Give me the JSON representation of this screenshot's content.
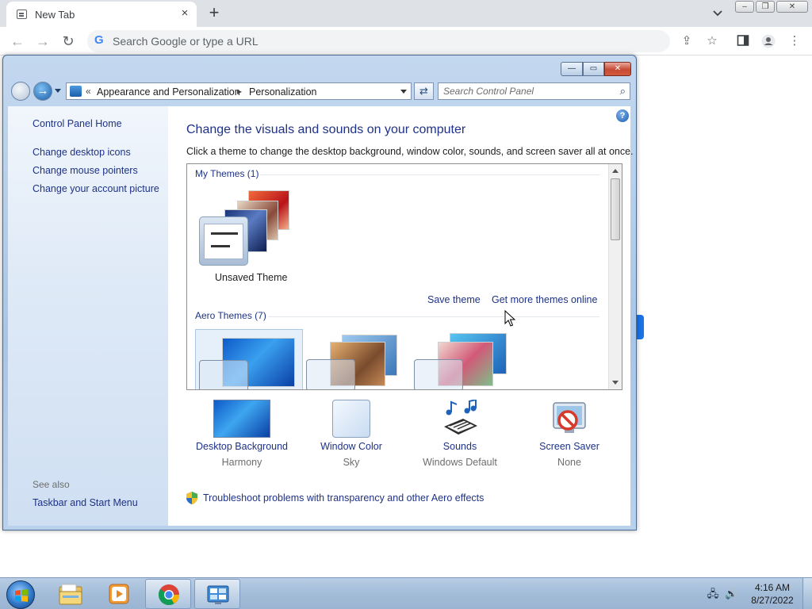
{
  "browser": {
    "tab_title": "New Tab",
    "tab_close": "×",
    "new_tab": "+",
    "omnibox_placeholder": "Search Google or type a URL",
    "back": "←",
    "forward": "→",
    "reload": "↻",
    "window_controls": {
      "minimize": "–",
      "maximize": "❐",
      "close": "✕"
    }
  },
  "control_panel": {
    "breadcrumb": {
      "chevrons": "«",
      "parent": "Appearance and Personalization",
      "sep": "▸",
      "current": "Personalization"
    },
    "search_placeholder": "Search Control Panel",
    "caption": {
      "minimize": "—",
      "maximize": "▭",
      "close": "✕"
    },
    "help": "?",
    "sidebar": {
      "home": "Control Panel Home",
      "links": [
        "Change desktop icons",
        "Change mouse pointers",
        "Change your account picture"
      ],
      "see_also_label": "See also",
      "see_also_links": [
        "Taskbar and Start Menu"
      ]
    },
    "heading": "Change the visuals and sounds on your computer",
    "subheading": "Click a theme to change the desktop background, window color, sounds, and screen saver all at once.",
    "themes": {
      "my_themes_label": "My Themes (1)",
      "unsaved_theme": "Unsaved Theme",
      "save_theme": "Save theme",
      "get_more": "Get more themes online",
      "aero_themes_label": "Aero Themes (7)"
    },
    "quick_settings": [
      {
        "label": "Desktop Background",
        "value": "Harmony",
        "icon": "desktop-background-icon"
      },
      {
        "label": "Window Color",
        "value": "Sky",
        "icon": "window-color-icon"
      },
      {
        "label": "Sounds",
        "value": "Windows Default",
        "icon": "sounds-icon"
      },
      {
        "label": "Screen Saver",
        "value": "None",
        "icon": "screen-saver-icon"
      }
    ],
    "troubleshoot": "Troubleshoot problems with transparency and other Aero effects"
  },
  "taskbar": {
    "clock_time": "4:16 AM",
    "clock_date": "8/27/2022",
    "buttons": [
      "file-explorer-icon",
      "media-player-icon",
      "chrome-icon",
      "control-panel-icon"
    ]
  }
}
